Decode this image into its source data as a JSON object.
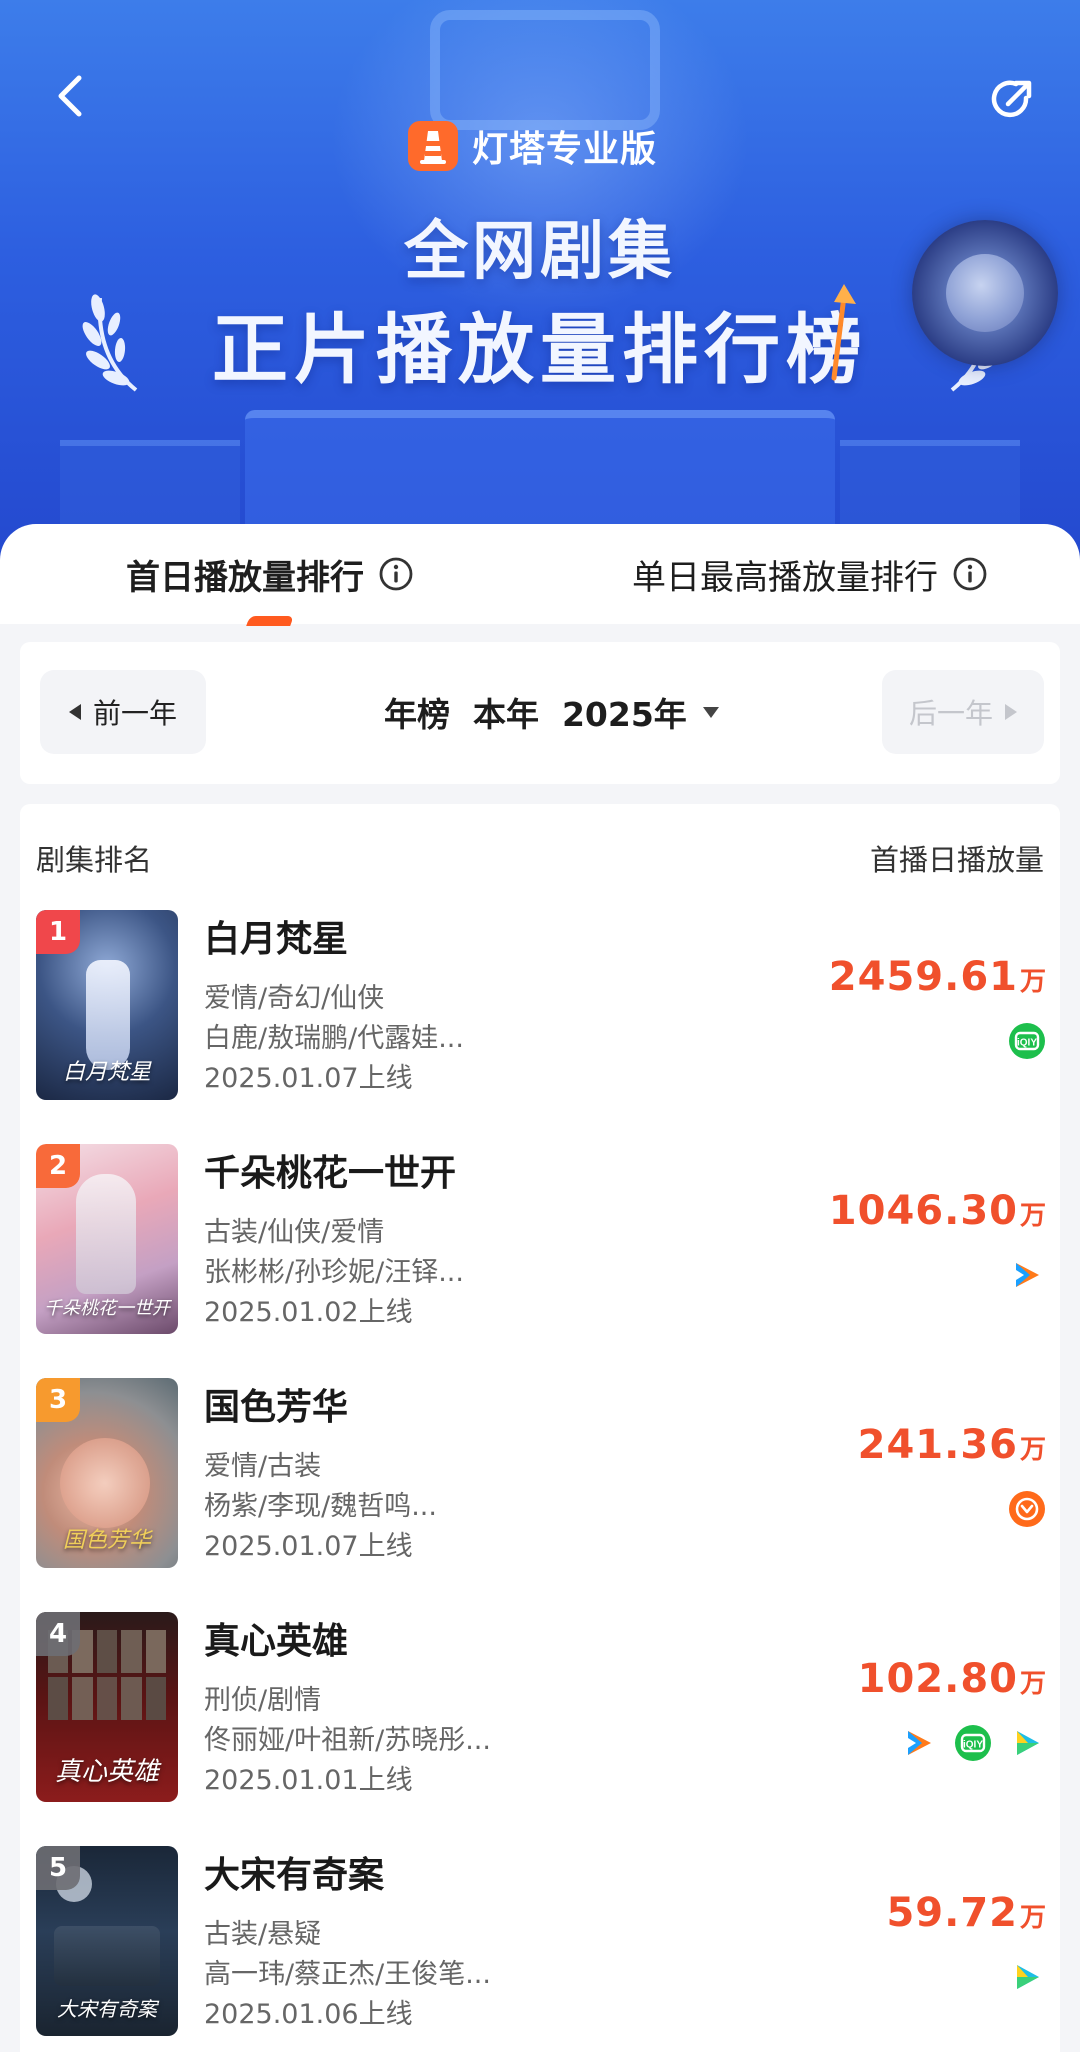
{
  "header": {
    "brand": "灯塔专业版",
    "title_line1": "全网剧集",
    "title_line2": "正片播放量排行榜"
  },
  "tabs": [
    {
      "label": "首日播放量排行",
      "active": true
    },
    {
      "label": "单日最高播放量排行",
      "active": false
    }
  ],
  "year_selector": {
    "prev_label": "前一年",
    "current": "年榜  本年  2025年",
    "next_label": "后一年"
  },
  "list": {
    "col_left": "剧集排名",
    "col_right": "首播日播放量",
    "unit": "万",
    "items": [
      {
        "rank": "1",
        "title": "白月梵星",
        "genre": "爱情/奇幻/仙侠",
        "cast": "白鹿/敖瑞鹏/代露娃...",
        "date": "2025.01.07上线",
        "value": "2459.61",
        "platforms": [
          "iqiyi"
        ],
        "poster_title": "白月梵星",
        "badge_color": "#f0474b"
      },
      {
        "rank": "2",
        "title": "千朵桃花一世开",
        "genre": "古装/仙侠/爱情",
        "cast": "张彬彬/孙珍妮/汪铎...",
        "date": "2025.01.02上线",
        "value": "1046.30",
        "platforms": [
          "tencent"
        ],
        "poster_title": "千朵桃花一世开",
        "badge_color": "#f86a3a"
      },
      {
        "rank": "3",
        "title": "国色芳华",
        "genre": "爱情/古装",
        "cast": "杨紫/李现/魏哲鸣...",
        "date": "2025.01.07上线",
        "value": "241.36",
        "platforms": [
          "mango"
        ],
        "poster_title": "国色芳华",
        "badge_color": "#f79a2e"
      },
      {
        "rank": "4",
        "title": "真心英雄",
        "genre": "刑侦/剧情",
        "cast": "佟丽娅/叶祖新/苏晓彤...",
        "date": "2025.01.01上线",
        "value": "102.80",
        "platforms": [
          "tencent",
          "iqiyi",
          "youku"
        ],
        "poster_title": "真心英雄",
        "badge_color": "#6b6b70"
      },
      {
        "rank": "5",
        "title": "大宋有奇案",
        "genre": "古装/悬疑",
        "cast": "高一玮/蔡正杰/王俊笔...",
        "date": "2025.01.06上线",
        "value": "59.72",
        "platforms": [
          "youku"
        ],
        "poster_title": "大宋有奇案",
        "badge_color": "#6b6b70"
      }
    ]
  }
}
